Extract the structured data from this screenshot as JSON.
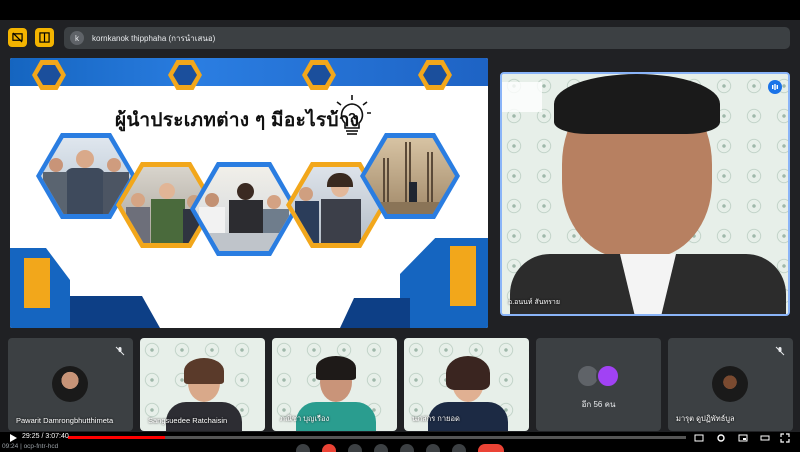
{
  "presenter_bar": {
    "avatar_letter": "k",
    "text": "kornkanok thipphaha (การนำเสนอ)"
  },
  "slide": {
    "title": "ผู้นำประเภทต่าง ๆ มีอะไรบ้าง",
    "question_mark": "?"
  },
  "speaker": {
    "name": "อ.อนนท์ สันทราย"
  },
  "participants": [
    {
      "name": "Pawarit Damrongbhutthimeta",
      "mic": "off"
    },
    {
      "name": "Sangsuedee Ratchaisin",
      "mic": "on"
    },
    {
      "name": "ภณิชา บุญเรือง",
      "mic": "on"
    },
    {
      "name": "นภสกร กายอด",
      "mic": "on"
    },
    {
      "name": "อีก 56 คน",
      "mic": "none"
    },
    {
      "name": "มารุต ดูปฏิพัทธ์บูล",
      "mic": "off"
    }
  ],
  "player": {
    "current": "29:25",
    "duration": "3:07:40",
    "progress_fraction": 0.157,
    "sub_text": "09:24 | ocp-fntr-hcd"
  },
  "colors": {
    "accent_blue": "#1565c0",
    "accent_orange": "#f2a71b",
    "speaker_border": "#8ab4f8",
    "progress": "#ff0000"
  }
}
